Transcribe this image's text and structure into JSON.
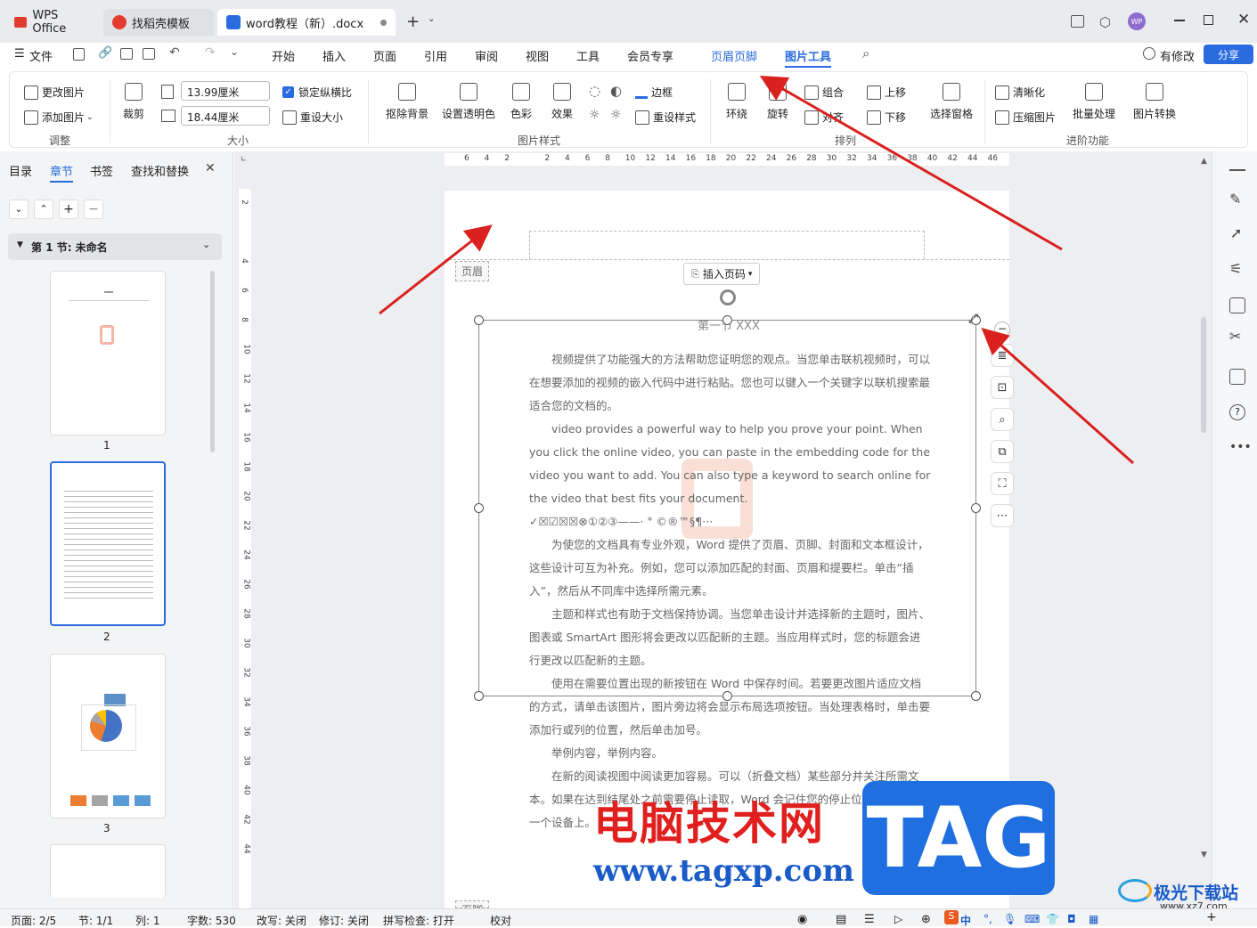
{
  "tabs": [
    {
      "label": "WPS Office",
      "icon": "wps-logo-icon"
    },
    {
      "label": "找稻壳模板",
      "icon": "docer-icon"
    },
    {
      "label": "word教程（新）.docx",
      "icon": "word-doc-icon"
    }
  ],
  "titlebar": {
    "new_tab": "+",
    "avatar": "WP"
  },
  "menu": {
    "file": "文件",
    "items": [
      "开始",
      "插入",
      "页面",
      "引用",
      "审阅",
      "视图",
      "工具",
      "会员专享",
      "页眉页脚",
      "图片工具"
    ],
    "modified": "有修改",
    "share": "分享"
  },
  "ribbon": {
    "change_pic": "更改图片",
    "add_pic": "添加图片",
    "group_adjust": "调整",
    "crop": "裁剪",
    "width_value": "13.99厘米",
    "height_value": "18.44厘米",
    "lock_ratio": "锁定纵横比",
    "resize": "重设大小",
    "group_size": "大小",
    "remove_bg": "抠除背景",
    "set_transparent": "设置透明色",
    "color": "色彩",
    "effect": "效果",
    "border": "边框",
    "reset_style": "重设样式",
    "group_picstyle": "图片样式",
    "wrap": "环绕",
    "rotate": "旋转",
    "group_combine": "组合",
    "align": "对齐",
    "bring_up": "上移",
    "send_down": "下移",
    "select_pane": "选择窗格",
    "group_arrange": "排列",
    "sharpen": "清晰化",
    "compress": "压缩图片",
    "batch": "批量处理",
    "convert": "图片转换",
    "group_advanced": "进阶功能"
  },
  "leftpanel": {
    "tabs": [
      "目录",
      "章节",
      "书签",
      "查找和替换"
    ],
    "section_title": "第 1 节: 未命名",
    "pages": [
      "1",
      "2",
      "3"
    ]
  },
  "ruler": {
    "h_ticks": [
      "6",
      "4",
      "2",
      "",
      "2",
      "4",
      "6",
      "8",
      "10",
      "12",
      "14",
      "16",
      "18",
      "20",
      "22",
      "24",
      "26",
      "28",
      "30",
      "32",
      "34",
      "36",
      "38",
      "40",
      "42",
      "44",
      "46"
    ],
    "v_ticks": [
      "2",
      "",
      "4",
      "6",
      "8",
      "10",
      "12",
      "14",
      "16",
      "18",
      "20",
      "22",
      "24",
      "26",
      "28",
      "30",
      "32",
      "34",
      "36",
      "38",
      "40",
      "42",
      "44"
    ]
  },
  "document": {
    "header_label": "页眉",
    "insert_page_num": "插入页码",
    "heading": "第一节 XXX",
    "paragraphs": [
      "视频提供了功能强大的方法帮助您证明您的观点。当您单击联机视频时，可以在想要添加的视频的嵌入代码中进行粘贴。您也可以键入一个关键字以联机搜索最适合您的文档的。",
      "video provides a powerful way to help you prove your point. When you click the online video, you can paste in the embedding code for the video you want to add. You can also type a keyword to search online for the video that best fits your document.",
      "✓☒☑☒☒⊗①②③——·  °  ©®™§¶···",
      "为使您的文档具有专业外观，Word 提供了页眉、页脚、封面和文本框设计，这些设计可互为补充。例如，您可以添加匹配的封面、页眉和提要栏。单击“插入”，然后从不同库中选择所需元素。",
      "主题和样式也有助于文档保持协调。当您单击设计并选择新的主题时，图片、图表或 SmartArt 图形将会更改以匹配新的主题。当应用样式时，您的标题会进行更改以匹配新的主题。",
      "使用在需要位置出现的新按钮在 Word 中保存时间。若要更改图片适应文档的方式，请单击该图片，图片旁边将会显示布局选项按钮。当处理表格时，单击要添加行或列的位置，然后单击加号。",
      "举例内容，举例内容。",
      "在新的阅读视图中阅读更加容易。可以（折叠文档）某些部分并关注所需文本。如果在达到结尾处之前需要停止读取，Word 会记住您的停止位置 - 即使在另一个设备上。"
    ],
    "footer_label": "页脚"
  },
  "watermark": {
    "brand": "电脑技术网",
    "url": "www.tagxp.com",
    "tag": "TAG",
    "corner": "极光下载站",
    "corner_url": "www.xz7.com"
  },
  "status": {
    "page": "页面: 2/5",
    "section": "节: 1/1",
    "col": "列: 1",
    "words": "字数: 530",
    "revise": "改写: 关闭",
    "track": "修订: 关闭",
    "spell": "拼写检查: 打开",
    "proof": "校对",
    "ime": "中"
  },
  "colors": {
    "accent": "#2a6bdf",
    "arrow": "#d9211f",
    "wps_red": "#e23c30"
  }
}
